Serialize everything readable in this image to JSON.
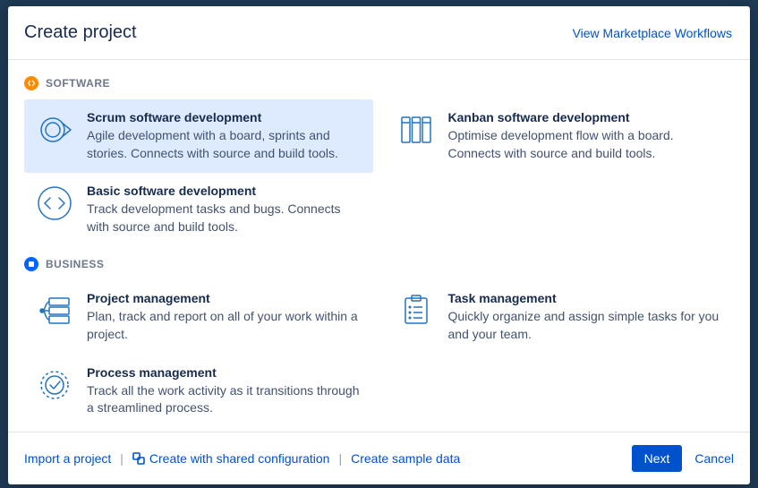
{
  "header": {
    "title": "Create project",
    "marketplace_link": "View Marketplace Workflows"
  },
  "categories": {
    "software": {
      "label": "SOFTWARE",
      "templates": [
        {
          "title": "Scrum software development",
          "desc": "Agile development with a board, sprints and stories. Connects with source and build tools.",
          "selected": true
        },
        {
          "title": "Kanban software development",
          "desc": "Optimise development flow with a board. Connects with source and build tools."
        },
        {
          "title": "Basic software development",
          "desc": "Track development tasks and bugs. Connects with source and build tools."
        }
      ]
    },
    "business": {
      "label": "BUSINESS",
      "templates": [
        {
          "title": "Project management",
          "desc": "Plan, track and report on all of your work within a project."
        },
        {
          "title": "Task management",
          "desc": "Quickly organize and assign simple tasks for you and your team."
        },
        {
          "title": "Process management",
          "desc": "Track all the work activity as it transitions through a streamlined process."
        }
      ]
    }
  },
  "footer": {
    "import_project": "Import a project",
    "shared_config": "Create with shared configuration",
    "sample_data": "Create sample data",
    "next": "Next",
    "cancel": "Cancel"
  }
}
